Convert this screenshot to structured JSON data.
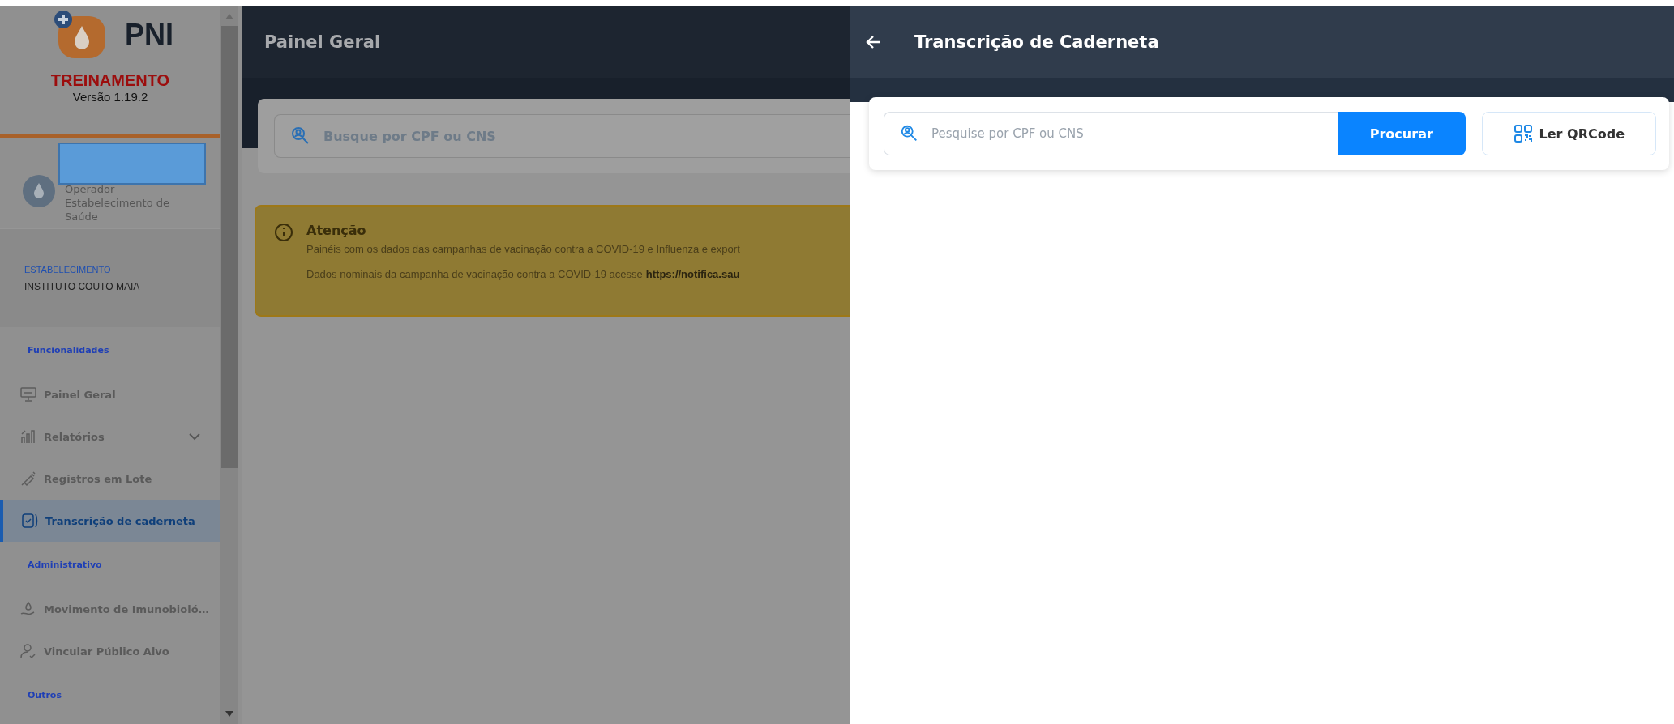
{
  "sidebar": {
    "logo_text": "PNI",
    "environment": "TREINAMENTO",
    "version": "Versão 1.19.2",
    "user": {
      "role": "Operador Estabelecimento de Saúde"
    },
    "establishment": {
      "label": "ESTABELECIMENTO",
      "name": "INSTITUTO COUTO MAIA"
    },
    "sections": [
      {
        "title": "Funcionalidades",
        "items": [
          {
            "label": "Painel Geral",
            "selected": false
          },
          {
            "label": "Relatórios",
            "selected": false,
            "expanded": false
          },
          {
            "label": "Registros em Lote",
            "selected": false
          },
          {
            "label": "Transcrição de caderneta",
            "selected": true
          }
        ]
      },
      {
        "title": "Administrativo",
        "items": [
          {
            "label": "Movimento de Imunobioló…",
            "selected": false
          },
          {
            "label": "Vincular Público Alvo",
            "selected": false
          }
        ]
      },
      {
        "title": "Outros"
      }
    ]
  },
  "main": {
    "title": "Painel Geral",
    "search": {
      "placeholder": "Busque por CPF ou CNS"
    },
    "alert": {
      "title": "Atenção",
      "text": "Painéis com os dados das campanhas de vacinação contra a COVID-19 e Influenza e export",
      "text2": "Dados nominais da campanha de vacinação contra a COVID-19 acesse",
      "link": "https://notifica.sau"
    }
  },
  "panel": {
    "title": "Transcrição de Caderneta",
    "search": {
      "placeholder": "Pesquise por CPF ou CNS"
    },
    "search_button": "Procurar",
    "qr_button": "Ler QRCode"
  }
}
